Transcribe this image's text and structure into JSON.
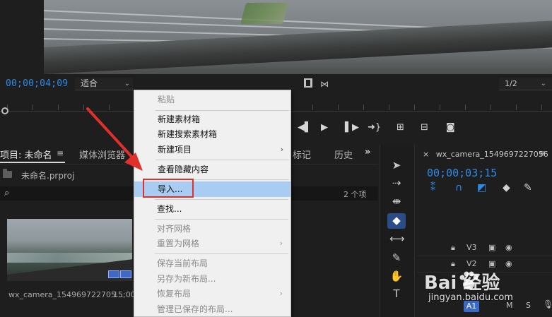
{
  "monitor": {
    "timecode": "00;00;04;09",
    "fit_value": "适合",
    "resolution_value": "1/2"
  },
  "project_panel": {
    "tabs": [
      {
        "label": "项目: 未命名",
        "active": true
      },
      {
        "label": "媒体浏览器",
        "active": false
      },
      {
        "label": "标记",
        "active": false
      },
      {
        "label": "历史",
        "active": false
      }
    ],
    "file_name": "未命名.prproj",
    "item_count": "2 个项",
    "clip": {
      "name": "wx_camera_154969722705...",
      "duration": "15;00"
    }
  },
  "timeline": {
    "sequence_tab": "wx_camera_1549697227056",
    "timecode": "00;00;03;15",
    "tracks": [
      {
        "label": "V3"
      },
      {
        "label": "V2"
      }
    ],
    "audio_track": "A1",
    "audio_toggles": [
      "M",
      "S"
    ]
  },
  "context_menu": {
    "items": [
      {
        "label": "粘贴",
        "disabled": true,
        "submenu": false
      },
      {
        "label": "新建素材箱",
        "disabled": false,
        "submenu": false
      },
      {
        "label": "新建搜索素材箱",
        "disabled": false,
        "submenu": false
      },
      {
        "label": "新建项目",
        "disabled": false,
        "submenu": true
      },
      {
        "label": "查看隐藏内容",
        "disabled": false,
        "submenu": false
      },
      {
        "label": "导入...",
        "disabled": false,
        "submenu": false,
        "highlighted": true
      },
      {
        "label": "查找...",
        "disabled": false,
        "submenu": false
      },
      {
        "label": "对齐网格",
        "disabled": true,
        "submenu": false
      },
      {
        "label": "重置为网格",
        "disabled": true,
        "submenu": true
      },
      {
        "label": "保存当前布局",
        "disabled": true,
        "submenu": false
      },
      {
        "label": "另存为新布局...",
        "disabled": true,
        "submenu": false
      },
      {
        "label": "恢复布局",
        "disabled": true,
        "submenu": true
      },
      {
        "label": "管理已保存的布局...",
        "disabled": true,
        "submenu": false
      }
    ]
  },
  "watermark": {
    "logo": "Bai  经验",
    "url": "jingyan.baidu.com"
  },
  "colors": {
    "accent_blue": "#2d8ceb",
    "menu_highlight": "#a9cdf2",
    "annotation_red": "#e0302c"
  }
}
